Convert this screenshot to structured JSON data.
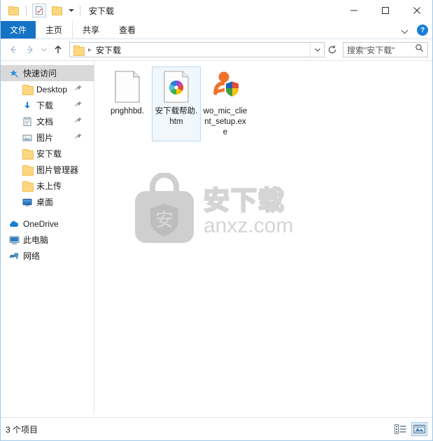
{
  "window": {
    "title": "安下载",
    "quick_access": [
      {
        "name": "folder-icon",
        "label": ""
      },
      {
        "name": "properties-icon",
        "label": ""
      },
      {
        "name": "new-folder-icon",
        "label": ""
      }
    ],
    "controls": {
      "minimize": "minimize-icon",
      "maximize": "maximize-icon",
      "close": "close-icon"
    }
  },
  "ribbon": {
    "tabs": [
      {
        "label": "文件",
        "active": true
      },
      {
        "label": "主页",
        "active": false
      },
      {
        "label": "共享",
        "active": false
      },
      {
        "label": "查看",
        "active": false
      }
    ],
    "collapse_icon": "chevron-down-icon",
    "help_label": "?"
  },
  "nav": {
    "back": "back-arrow-icon",
    "forward": "forward-arrow-icon",
    "recent": "chevron-down-icon",
    "up": "up-arrow-icon",
    "breadcrumb": [
      {
        "label": "安下载"
      }
    ],
    "address_dropdown": "chevron-down-icon",
    "refresh": "refresh-icon"
  },
  "search": {
    "placeholder": "搜索\"安下载\"",
    "icon": "search-icon"
  },
  "sidebar": {
    "items": [
      {
        "label": "快速访问",
        "icon": "star-pin-icon",
        "level": 0,
        "selected": true,
        "pinned": false
      },
      {
        "label": "Desktop",
        "icon": "folder-icon",
        "level": 1,
        "selected": false,
        "pinned": true
      },
      {
        "label": "下载",
        "icon": "download-icon",
        "level": 1,
        "selected": false,
        "pinned": true
      },
      {
        "label": "文档",
        "icon": "documents-icon",
        "level": 1,
        "selected": false,
        "pinned": true
      },
      {
        "label": "图片",
        "icon": "pictures-icon",
        "level": 1,
        "selected": false,
        "pinned": true
      },
      {
        "label": "安下载",
        "icon": "folder-icon",
        "level": 1,
        "selected": false,
        "pinned": false
      },
      {
        "label": "图片管理器",
        "icon": "folder-icon",
        "level": 1,
        "selected": false,
        "pinned": false
      },
      {
        "label": "未上传",
        "icon": "folder-icon",
        "level": 1,
        "selected": false,
        "pinned": false
      },
      {
        "label": "桌面",
        "icon": "desktop-icon",
        "level": 1,
        "selected": false,
        "pinned": false
      },
      {
        "label": "OneDrive",
        "icon": "onedrive-cloud-icon",
        "level": 0,
        "selected": false,
        "pinned": false
      },
      {
        "label": "此电脑",
        "icon": "this-pc-icon",
        "level": 0,
        "selected": false,
        "pinned": false
      },
      {
        "label": "网络",
        "icon": "network-icon",
        "level": 0,
        "selected": false,
        "pinned": false
      }
    ]
  },
  "files": [
    {
      "name": "pnghhbd.",
      "icon": "blank-page-icon",
      "selected": false
    },
    {
      "name": "安下载帮助.htm",
      "icon": "html-pinwheel-icon",
      "selected": true
    },
    {
      "name": "wo_mic_client_setup.exe",
      "icon": "installer-shield-icon",
      "selected": false
    }
  ],
  "watermark": {
    "logo": "anxz-bag-icon",
    "badge_char": "安",
    "text_cn": "安下载",
    "text_en": "anxz.com"
  },
  "status": {
    "item_count": "3 个项目",
    "views": [
      {
        "name": "details-view-icon",
        "active": false
      },
      {
        "name": "large-icons-view-icon",
        "active": true
      }
    ]
  },
  "colors": {
    "accent_blue": "#1573c6",
    "window_border": "#9ec7e8",
    "selection_fill": "#f0f7fd",
    "selection_border": "#bcdaf0",
    "sidebar_selected": "#d9d9d9",
    "folder_yellow": "#fcd77f",
    "watermark_gray": "#d5d5d5"
  }
}
